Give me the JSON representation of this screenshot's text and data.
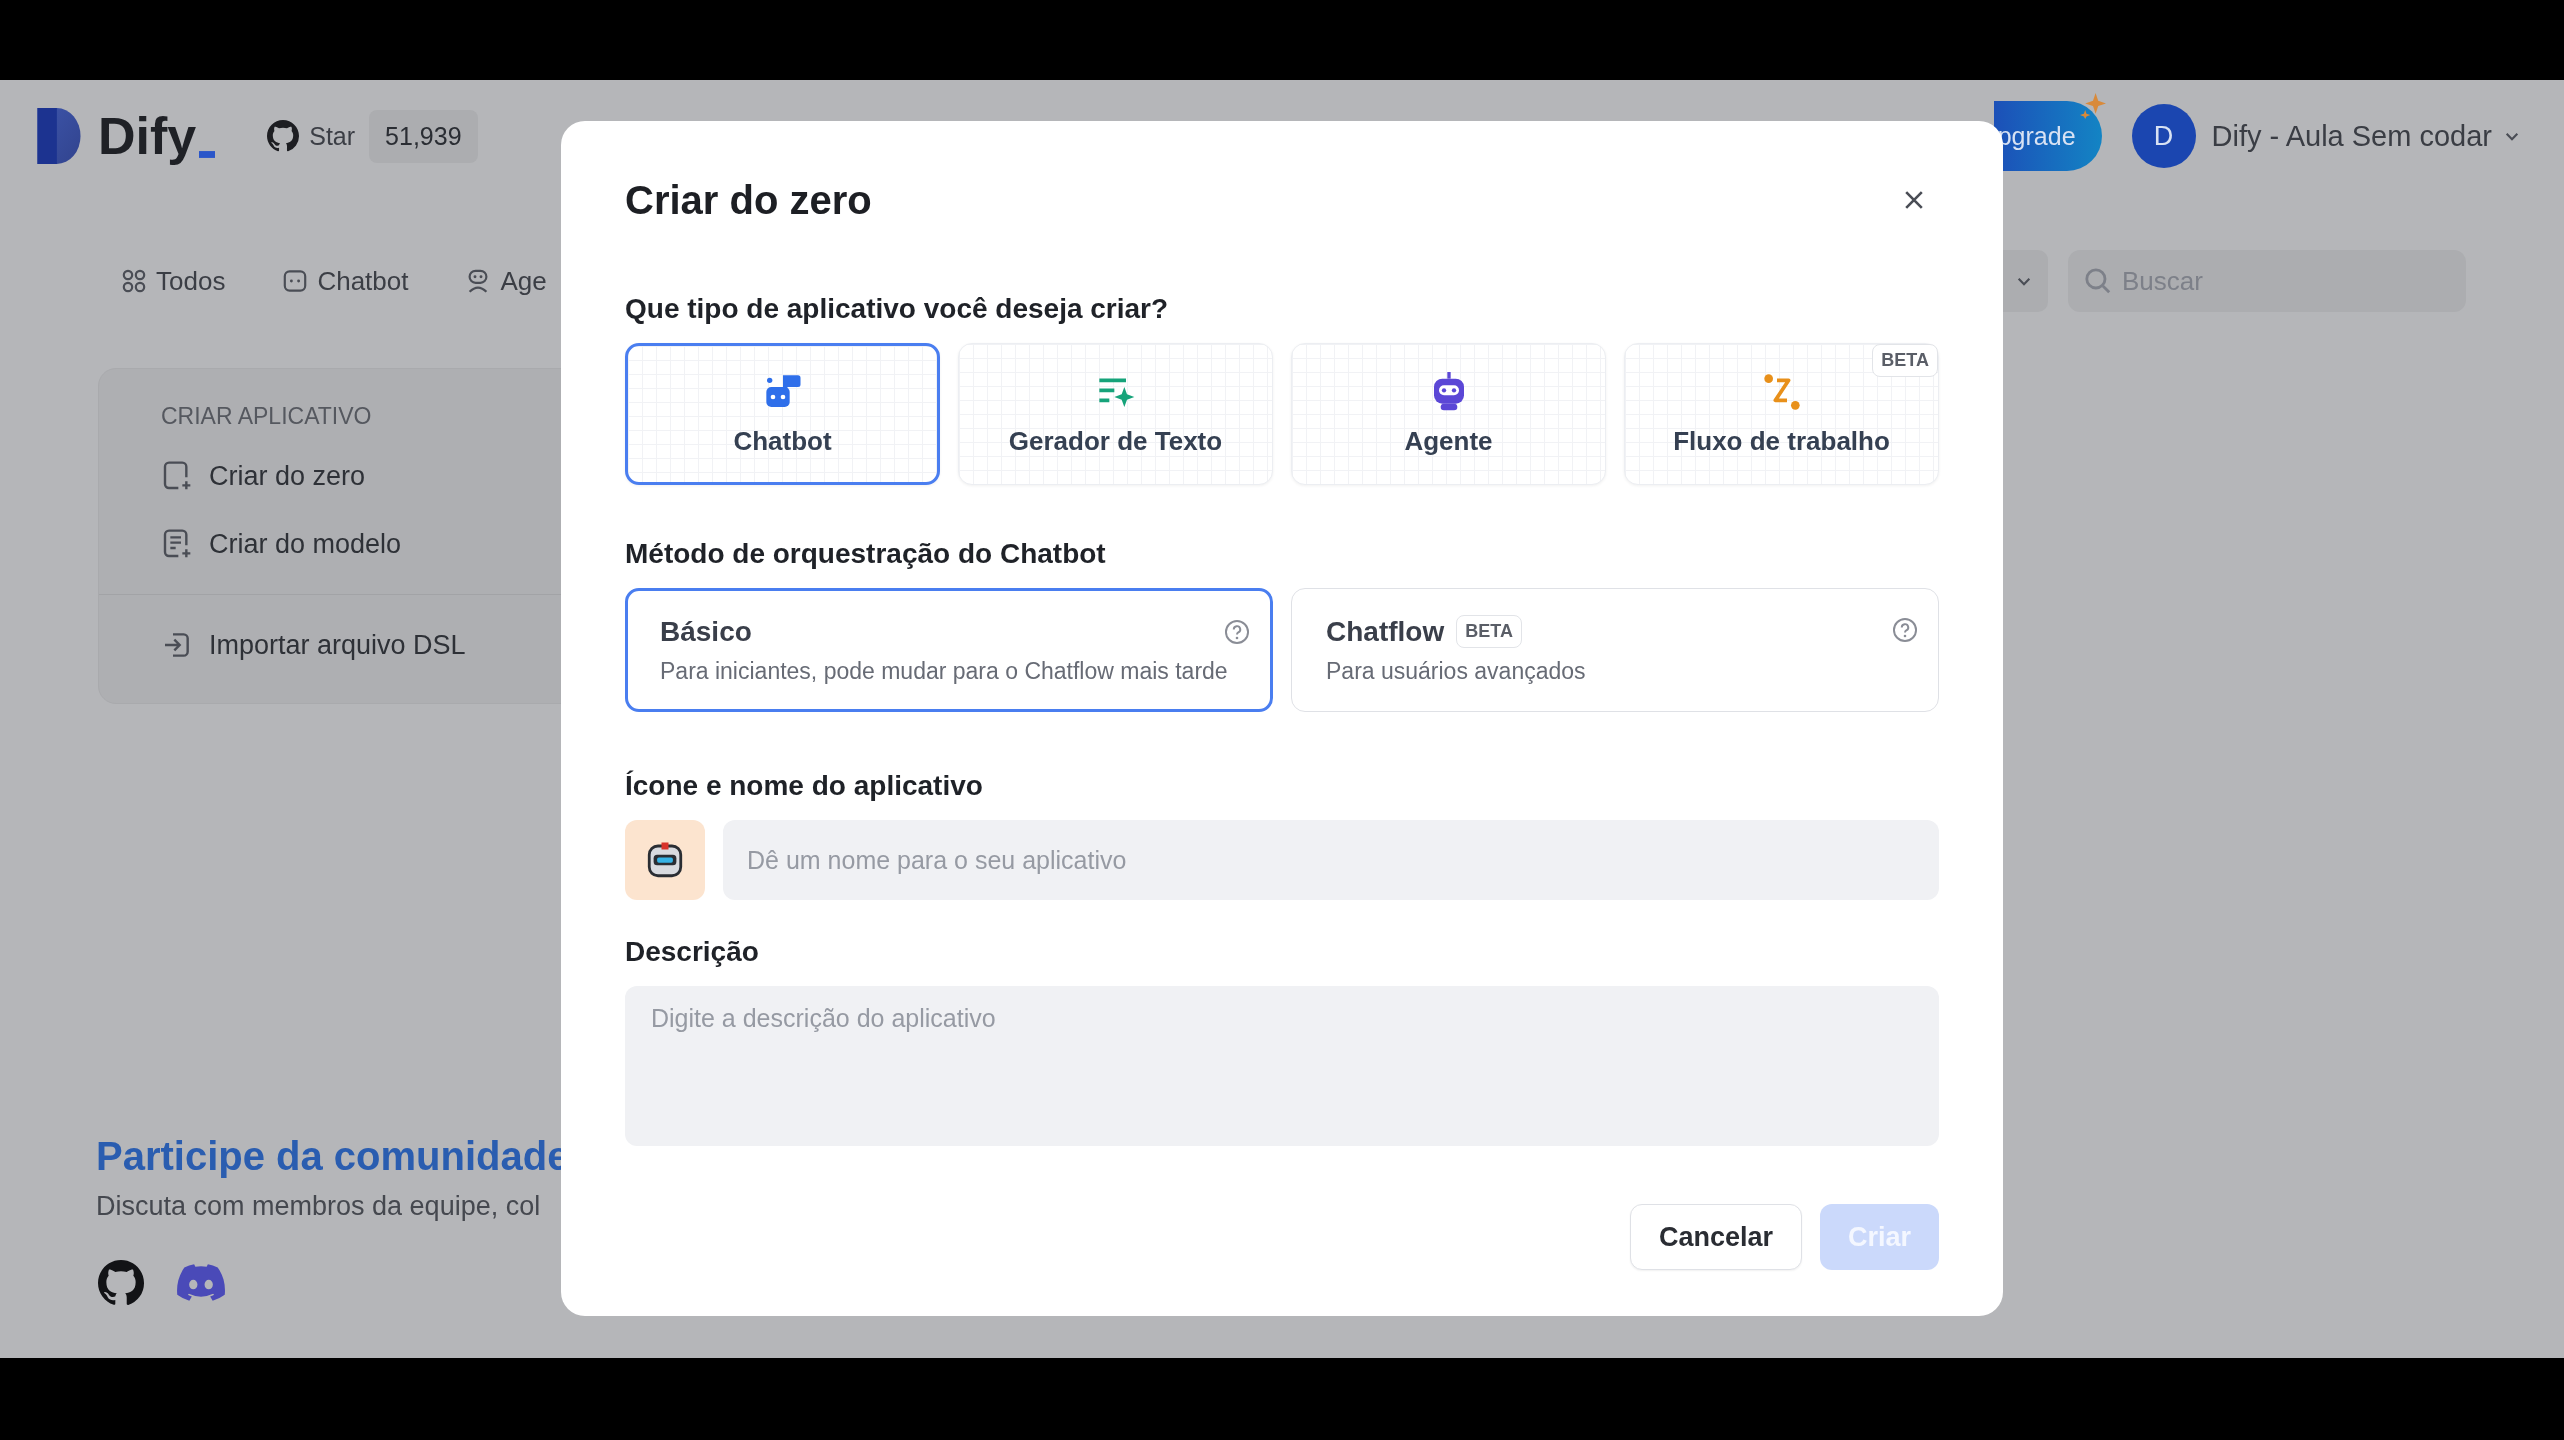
{
  "header": {
    "logo": "Dify",
    "star_label": "Star",
    "star_count": "51,939",
    "upgrade": "pgrade",
    "avatar_initial": "D",
    "account": "Dify - Aula Sem codar"
  },
  "filter_tabs": [
    {
      "label": "Todos"
    },
    {
      "label": "Chatbot"
    },
    {
      "label": "Age"
    }
  ],
  "search": {
    "placeholder": "Buscar"
  },
  "create_menu": {
    "heading": "CRIAR APLICATIVO",
    "items": [
      {
        "label": "Criar do zero"
      },
      {
        "label": "Criar do modelo"
      },
      {
        "label": "Importar arquivo DSL"
      }
    ]
  },
  "community": {
    "title": "Participe da comunidade",
    "text": "Discuta com membros da equipe, col"
  },
  "dialog": {
    "title": "Criar do zero",
    "type_question": "Que tipo de aplicativo você deseja criar?",
    "app_types": [
      {
        "kind": "chatbot",
        "label": "Chatbot",
        "selected": true
      },
      {
        "kind": "text",
        "label": "Gerador de Texto",
        "selected": false
      },
      {
        "kind": "agent",
        "label": "Agente",
        "selected": false
      },
      {
        "kind": "workflow",
        "label": "Fluxo de trabalho",
        "selected": false,
        "badge": "BETA"
      }
    ],
    "method_heading": "Método de orquestração do Chatbot",
    "methods": [
      {
        "title": "Básico",
        "description": "Para iniciantes, pode mudar para o Chatflow mais tarde",
        "selected": true
      },
      {
        "title": "Chatflow",
        "badge": "BETA",
        "description": "Para usuários avançados",
        "selected": false
      }
    ],
    "name_heading": "Ícone e nome do aplicativo",
    "name_field": {
      "placeholder": "Dê um nome para o seu aplicativo"
    },
    "description_heading": "Descrição",
    "description_field": {
      "placeholder": "Digite a descrição do aplicativo"
    },
    "buttons": [
      {
        "label": "Cancelar",
        "kind": "secondary",
        "disabled": false
      },
      {
        "label": "Criar",
        "kind": "primary",
        "disabled": true
      }
    ]
  }
}
